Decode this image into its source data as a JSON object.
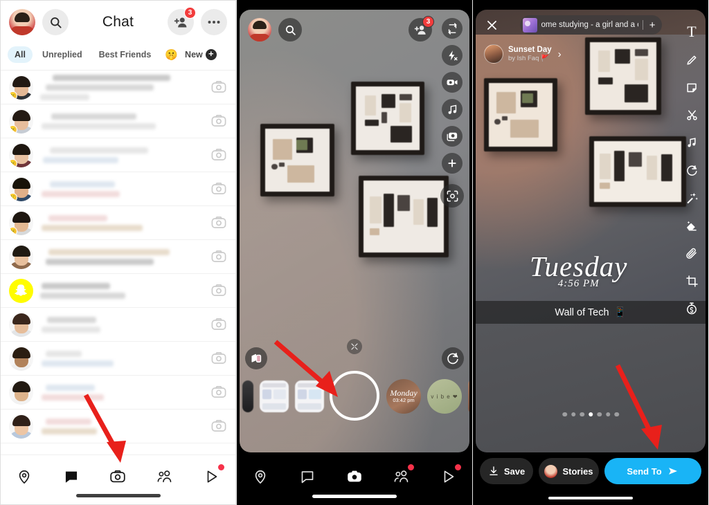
{
  "app": {
    "name": "Snapchat"
  },
  "panel_chat": {
    "header": {
      "title": "Chat",
      "avatar_name": "profile-avatar",
      "search_icon": "search-icon",
      "add_friend_icon": "add-friend-icon",
      "add_friend_badge": "3",
      "more_icon": "more-options-icon"
    },
    "tabs": [
      {
        "label": "All",
        "active": true
      },
      {
        "label": "Unreplied",
        "active": false
      },
      {
        "label": "Best Friends",
        "active": false
      },
      {
        "label": "🤫",
        "active": false,
        "is_emoji": true
      },
      {
        "label": "New",
        "active": false,
        "has_plus": true
      }
    ],
    "rows": [
      {
        "avatar": "bitmoji-male-beard",
        "hair": "#221a14",
        "skin": "#e4b996",
        "body": "#2f3338",
        "status": "😐",
        "lines": [
          [
            18,
            72
          ],
          [
            8,
            66
          ],
          [
            0,
            0
          ]
        ]
      },
      {
        "avatar": "bitmoji-female-dark-hair",
        "hair": "#241a13",
        "skin": "#e7bd9c",
        "body": "#c6ccd4",
        "status": "😐",
        "lines": [
          [
            16,
            52
          ],
          [
            2,
            70
          ]
        ]
      },
      {
        "avatar": "bitmoji-male-short",
        "hair": "#1e1710",
        "skin": "#e9c2a2",
        "body": "#70353a",
        "status": "😐",
        "lines": [
          [
            14,
            60
          ],
          [
            4,
            46
          ]
        ]
      },
      {
        "avatar": "bitmoji-male-dark",
        "hair": "#171208",
        "skin": "#dfb089",
        "body": "#2f4a68",
        "status": "🙂",
        "lines": [
          [
            14,
            40
          ],
          [
            2,
            48
          ]
        ]
      },
      {
        "avatar": "bitmoji-male-beard-2",
        "hair": "#1d1610",
        "skin": "#e3b993",
        "body": "#d7d9da",
        "status": "😐",
        "lines": [
          [
            12,
            36
          ],
          [
            2,
            62
          ]
        ]
      },
      {
        "avatar": "bitmoji-male-plain",
        "hair": "#201a12",
        "skin": "#e8c09d",
        "body": "#8f6a4c",
        "status": "",
        "lines": [
          [
            12,
            74
          ],
          [
            8,
            66
          ]
        ]
      },
      {
        "avatar": "snapchat-logo",
        "snap": true,
        "lines": [
          [
            2,
            42
          ],
          [
            0,
            52
          ]
        ]
      },
      {
        "avatar": "bitmoji-female-long-hair",
        "hair": "#3b271c",
        "skin": "#e6bd9a",
        "body": "#e3e5e7",
        "status": "",
        "lines": [
          [
            10,
            30
          ],
          [
            2,
            36
          ]
        ]
      },
      {
        "avatar": "bitmoji-male-glasses",
        "hair": "#2a1d11",
        "skin": "#b1825a",
        "body": "#efefef",
        "status": "",
        "lines": [
          [
            8,
            22
          ],
          [
            2,
            44
          ]
        ]
      },
      {
        "avatar": "bitmoji-male-glasses-beard",
        "hair": "#221a12",
        "skin": "#ddb38b",
        "body": "#f2f2f2",
        "status": "",
        "lines": [
          [
            8,
            30
          ],
          [
            2,
            38
          ]
        ]
      },
      {
        "avatar": "bitmoji-female-2",
        "hair": "#2f2018",
        "skin": "#ecc5a4",
        "body": "#b8c8dc",
        "status": "",
        "lines": [
          [
            8,
            28
          ],
          [
            2,
            34
          ]
        ]
      }
    ],
    "compose_icon": "new-chat-icon",
    "bottom_nav": [
      {
        "icon": "map-pin-icon",
        "name": "map",
        "active": false,
        "dot": false
      },
      {
        "icon": "chat-bubble-icon",
        "name": "chat",
        "active": true,
        "dot": false
      },
      {
        "icon": "camera-icon",
        "name": "camera",
        "active": false,
        "dot": false
      },
      {
        "icon": "friends-icon",
        "name": "friends",
        "active": false,
        "dot": false
      },
      {
        "icon": "play-icon",
        "name": "spotlight",
        "active": false,
        "dot": true
      }
    ]
  },
  "panel_camera": {
    "top_left": [
      {
        "icon": "profile-avatar",
        "name": "profile"
      },
      {
        "icon": "search-icon",
        "name": "search"
      }
    ],
    "add_friend_badge": "3",
    "right_rail": [
      {
        "icon": "flip-camera-icon",
        "name": "flip-camera"
      },
      {
        "icon": "flash-off-icon",
        "name": "flash-off"
      },
      {
        "icon": "night-video-icon",
        "name": "night-mode"
      },
      {
        "icon": "music-note-icon",
        "name": "music"
      },
      {
        "icon": "multi-snap-icon",
        "name": "multi-snap"
      },
      {
        "icon": "plus-icon",
        "name": "more-tools"
      },
      {
        "icon": "scan-icon",
        "name": "scan"
      }
    ],
    "shutter_name": "shutter-button",
    "lens_carousel": [
      {
        "label": "",
        "name": "lens-thumb-1",
        "type": "card"
      },
      {
        "label": "",
        "name": "lens-thumb-2",
        "type": "card"
      },
      {
        "label": "",
        "name": "lens-thumb-3",
        "type": "card"
      },
      {
        "label": "Monday",
        "sub": "03:42 pm",
        "name": "lens-monday",
        "type": "circle"
      },
      {
        "label": "v i b e ❤",
        "name": "lens-vibe",
        "type": "circle"
      },
      {
        "label": "",
        "name": "lens-thumb-6",
        "type": "circle"
      }
    ],
    "explore_icon": "lens-explore-icon",
    "discover_icon": "lens-discover-icon",
    "collapse_icon": "collapse-icon",
    "bottom_nav": [
      {
        "icon": "map-pin-icon",
        "name": "map",
        "active": false,
        "dot": false
      },
      {
        "icon": "chat-bubble-icon",
        "name": "chat",
        "active": false,
        "dot": false
      },
      {
        "icon": "camera-icon",
        "name": "camera",
        "active": true,
        "dot": false
      },
      {
        "icon": "friends-icon",
        "name": "friends",
        "active": false,
        "dot": true
      },
      {
        "icon": "play-icon",
        "name": "spotlight",
        "active": false,
        "dot": true
      }
    ]
  },
  "panel_editor": {
    "close_icon": "close-icon",
    "music": {
      "title": "ome studying - a girl and a cat",
      "add_label": "+",
      "art_name": "album-art"
    },
    "attribution": {
      "name": "Sunset Day",
      "by": "by Ish Faq 🚩",
      "chevron": "›"
    },
    "right_rail": [
      {
        "icon": "text-icon",
        "name": "add-text",
        "glyph": "T"
      },
      {
        "icon": "pencil-icon",
        "name": "draw"
      },
      {
        "icon": "sticker-icon",
        "name": "stickers"
      },
      {
        "icon": "scissors-icon",
        "name": "cutout"
      },
      {
        "icon": "music-note-icon",
        "name": "music"
      },
      {
        "icon": "lens-icon",
        "name": "lenses"
      },
      {
        "icon": "magic-wand-icon",
        "name": "magic-eraser"
      },
      {
        "icon": "eraser-icon",
        "name": "eraser"
      },
      {
        "icon": "paperclip-icon",
        "name": "attach-link"
      },
      {
        "icon": "crop-icon",
        "name": "crop"
      },
      {
        "icon": "timer-icon",
        "name": "timer"
      }
    ],
    "day_sticker": {
      "day": "Tuesday",
      "time": "4:56 PM"
    },
    "caption": {
      "text": "Wall of Tech",
      "emoji": "📱"
    },
    "carousel_dots": {
      "count": 7,
      "active_index": 3
    },
    "actions": {
      "save_label": "Save",
      "save_icon": "download-icon",
      "stories_label": "Stories",
      "stories_avatar": "profile-avatar",
      "send_label": "Send To",
      "send_icon": "send-arrow-icon"
    }
  },
  "annotations": {
    "arrow_color": "#e8201b",
    "arrows": [
      {
        "name": "arrow-to-camera-tab",
        "target": "camera-nav-button"
      },
      {
        "name": "arrow-to-shutter",
        "target": "shutter-button"
      },
      {
        "name": "arrow-to-send-to",
        "target": "send-to-button"
      }
    ]
  }
}
